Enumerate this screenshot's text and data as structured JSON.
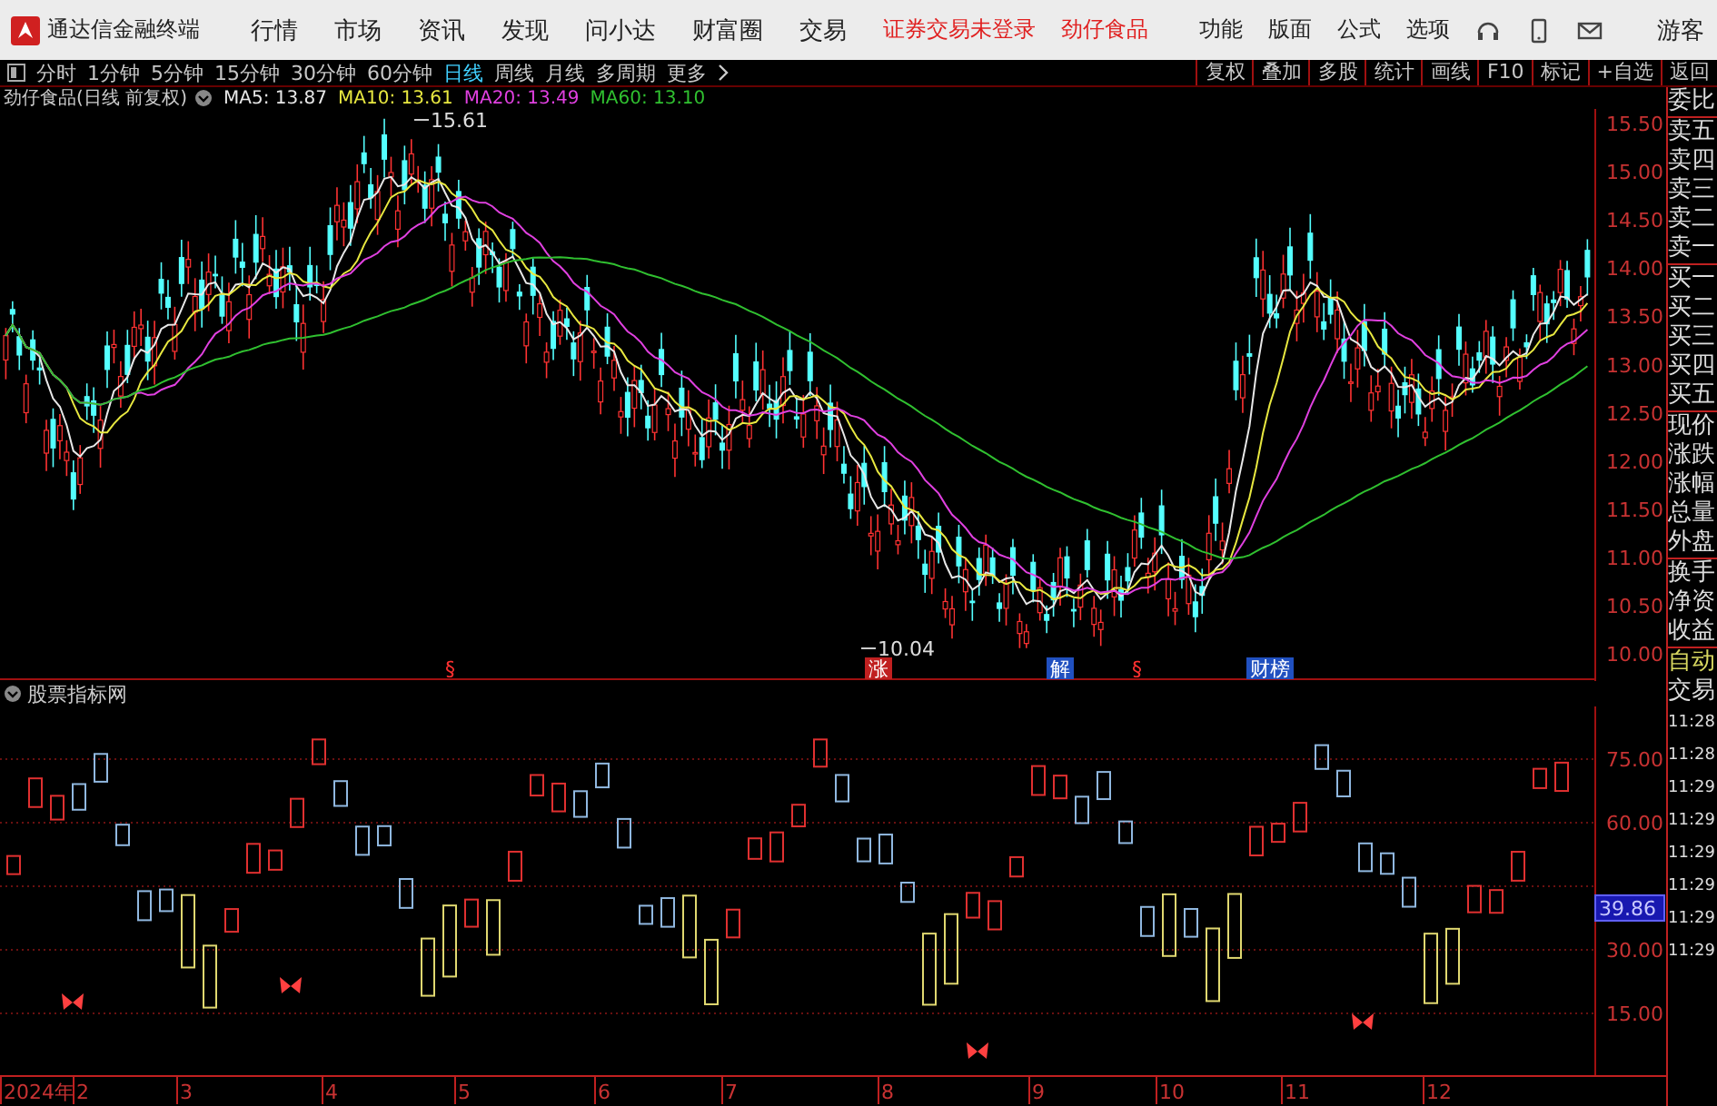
{
  "app": {
    "title": "通达信金融终端"
  },
  "menu": [
    "行情",
    "市场",
    "资讯",
    "发现",
    "问小达",
    "财富圈",
    "交易"
  ],
  "login_status": "证券交易未登录",
  "stock_name": "劲仔食品",
  "header_actions": [
    "功能",
    "版面",
    "公式",
    "选项"
  ],
  "user": "游客",
  "periods": [
    {
      "label": "分时",
      "selected": false
    },
    {
      "label": "1分钟",
      "selected": false
    },
    {
      "label": "5分钟",
      "selected": false
    },
    {
      "label": "15分钟",
      "selected": false
    },
    {
      "label": "30分钟",
      "selected": false
    },
    {
      "label": "60分钟",
      "selected": false
    },
    {
      "label": "日线",
      "selected": true
    },
    {
      "label": "周线",
      "selected": false
    },
    {
      "label": "月线",
      "selected": false
    },
    {
      "label": "多周期",
      "selected": false
    },
    {
      "label": "更多",
      "selected": false
    }
  ],
  "tools": [
    "复权",
    "叠加",
    "多股",
    "统计",
    "画线",
    "F10",
    "标记",
    "+自选",
    "返回"
  ],
  "chart_title": "劲仔食品(日线 前复权)",
  "moving_averages": [
    {
      "label": "MA5: 13.87",
      "color": "#e8e8e8"
    },
    {
      "label": "MA10: 13.61",
      "color": "#e8e840"
    },
    {
      "label": "MA20: 13.49",
      "color": "#e040e0"
    },
    {
      "label": "MA60: 13.10",
      "color": "#30c030"
    }
  ],
  "price_axis": [
    "15.50",
    "15.00",
    "14.50",
    "14.00",
    "13.50",
    "13.00",
    "12.50",
    "12.00",
    "11.50",
    "11.00",
    "10.50",
    "10.00"
  ],
  "extremes": {
    "high": "15.61",
    "low": "10.04"
  },
  "event_marks": [
    {
      "text": "§",
      "color": "#ff3030",
      "kind": "plain"
    },
    {
      "text": "涨",
      "color": "#c02020",
      "kind": "boxed"
    },
    {
      "text": "解",
      "color": "#2050c0",
      "kind": "boxed"
    },
    {
      "text": "§",
      "color": "#ff3030",
      "kind": "plain"
    },
    {
      "text": "财榜",
      "color": "#2050c0",
      "kind": "boxed"
    }
  ],
  "indicator": {
    "title": "股票指标网",
    "axis": [
      "75.00",
      "60.00",
      "30.00",
      "15.00"
    ],
    "current_value": "39.86"
  },
  "x_axis": [
    "2024年",
    "2",
    "3",
    "4",
    "5",
    "6",
    "7",
    "8",
    "9",
    "10",
    "11",
    "12"
  ],
  "quote_panel": {
    "sections": [
      [
        "委比"
      ],
      [
        "卖五",
        "卖四",
        "卖三",
        "卖二",
        "卖一"
      ],
      [
        "买一",
        "买二",
        "买三",
        "买四",
        "买五"
      ],
      [
        "现价",
        "涨跌",
        "涨幅",
        "总量",
        "外盘"
      ],
      [
        "换手",
        "净资",
        "收益"
      ]
    ],
    "auto": "自动",
    "trade": "交易",
    "times": [
      "11:28",
      "11:28",
      "11:29",
      "11:29",
      "11:29",
      "11:29",
      "11:29",
      "11:29"
    ]
  }
}
